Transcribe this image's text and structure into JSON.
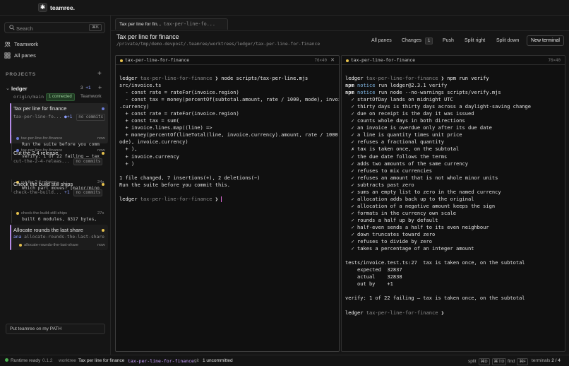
{
  "app": {
    "name": "teamree."
  },
  "sidebar": {
    "search": {
      "label": "Search",
      "shortcut": "⌘K"
    },
    "nav": [
      {
        "label": "Teamwork",
        "icon": "team-icon"
      },
      {
        "label": "All panes",
        "icon": "grid-icon"
      }
    ],
    "projects_label": "PROJECTS",
    "project": {
      "name": "ledger",
      "count_a": "3",
      "count_b": "+1",
      "branch": "origin/main",
      "connected": "1 connected",
      "team": "Teamwork"
    },
    "worktrees": [
      {
        "title": "Tax per line for finance",
        "branch": "tax-per-line-fo...",
        "badge_count": "+1",
        "badge": "no commits",
        "events": [
          {
            "name": "tax-per-line-for-finance",
            "time": "now",
            "msg": "Run the suite before you commit..."
          },
          {
            "name": "tax-per-line-for-finance",
            "time": "now",
            "msg": "verify: 1 of 22 failing — tax is..."
          }
        ]
      },
      {
        "title": "Cut the 2.4 release",
        "branch": "cut-the-2-4-releas...",
        "badge": "no commits",
        "events": [
          {
            "name": "cut-the-2-4-release",
            "time": "24s",
            "msg": "Which part moves? [major/minor/..."
          }
        ]
      },
      {
        "title": "Check the build still ships",
        "branch": "check-the-build...",
        "badge_count": "+1",
        "badge": "no commits",
        "events": [
          {
            "name": "check-the-build-still-ships",
            "time": "27s",
            "msg": "built 6 modules, 8317 bytes, 112..."
          }
        ]
      },
      {
        "title": "Allocate rounds the last share",
        "author": "ana",
        "branch": "allocate-rounds-the-last-share",
        "events": [
          {
            "name": "allocate-rounds-the-last-share",
            "time": "now",
            "msg": ""
          }
        ]
      }
    ],
    "path_button": "Put teamree on my PATH"
  },
  "header": {
    "tab": {
      "title": "Tax per line for fin...",
      "branch": "tax-per-line-fo..."
    },
    "title": "Tax per line for finance",
    "path": "/private/tmp/demo-devpost/.teamree/worktrees/ledger/tax-per-line-for-finance",
    "buttons": {
      "all_panes": "All panes",
      "changes": "Changes",
      "changes_count": "1",
      "push": "Push",
      "split_right": "Split right",
      "split_down": "Split down",
      "new_terminal": "New terminal"
    }
  },
  "panes": {
    "left": {
      "title": "tax-per-line-for-finance",
      "size": "76×40",
      "lines": [
        [
          [
            "c-white",
            "ledger "
          ],
          [
            "c-dim",
            "tax-per-line-for-finance "
          ],
          [
            "c-white",
            "❯ node scripts/tax-per-line.mjs"
          ]
        ],
        [
          [
            "c-ok",
            "src/invoice.ts"
          ]
        ],
        [
          [
            "c-ok",
            "  - const rate = rateFor(invoice.region)"
          ]
        ],
        [
          [
            "c-ok",
            "  - const tax = money(percentOf(subtotal.amount, rate / 1000, mode), invoice"
          ]
        ],
        [
          [
            "c-ok",
            ".currency)"
          ]
        ],
        [
          [
            "c-ok",
            "  + const rate = rateFor(invoice.region)"
          ]
        ],
        [
          [
            "c-ok",
            "  + const tax = sum("
          ]
        ],
        [
          [
            "c-ok",
            "  + invoice.lines.map((line) =>"
          ]
        ],
        [
          [
            "c-ok",
            "  + money(percentOf(lineTotal(line, invoice.currency).amount, rate / 1000, m"
          ]
        ],
        [
          [
            "c-ok",
            "ode), invoice.currency)"
          ]
        ],
        [
          [
            "c-ok",
            "  + ),"
          ]
        ],
        [
          [
            "c-ok",
            "  + invoice.currency"
          ]
        ],
        [
          [
            "c-ok",
            "  + )"
          ]
        ],
        [
          [
            "c-ok",
            ""
          ]
        ],
        [
          [
            "c-ok",
            "1 file changed, 7 insertions(+), 2 deletions(−)"
          ]
        ],
        [
          [
            "c-ok",
            "Run the suite before you commit this."
          ]
        ],
        [
          [
            "c-ok",
            ""
          ]
        ],
        [
          [
            "c-white",
            "ledger "
          ],
          [
            "c-dim",
            "tax-per-line-for-finance "
          ],
          [
            "c-white",
            "❯ "
          ],
          [
            "caret",
            ""
          ]
        ]
      ]
    },
    "right": {
      "title": "tax-per-line-for-finance",
      "size": "76×40",
      "lines": [
        [
          [
            "c-white",
            "ledger "
          ],
          [
            "c-dim",
            "tax-per-line-for-finance "
          ],
          [
            "c-white",
            "❯ npm run verify"
          ]
        ],
        [
          [
            "c-npm",
            "npm "
          ],
          [
            "c-notice",
            "notice "
          ],
          [
            "c-ok",
            "run ledger@2.3.1 verify"
          ]
        ],
        [
          [
            "c-npm",
            "npm "
          ],
          [
            "c-notice",
            "notice "
          ],
          [
            "c-ok",
            "run node --no-warnings scripts/verify.mjs"
          ]
        ],
        [
          [
            "c-ok",
            "  ✓ startOfDay lands on midnight UTC"
          ]
        ],
        [
          [
            "c-ok",
            "  ✓ thirty days is thirty days across a daylight-saving change"
          ]
        ],
        [
          [
            "c-ok",
            "  ✓ due on receipt is the day it was issued"
          ]
        ],
        [
          [
            "c-ok",
            "  ✓ counts whole days in both directions"
          ]
        ],
        [
          [
            "c-ok",
            "  ✓ an invoice is overdue only after its due date"
          ]
        ],
        [
          [
            "c-ok",
            "  ✓ a line is quantity times unit price"
          ]
        ],
        [
          [
            "c-ok",
            "  ✓ refuses a fractional quantity"
          ]
        ],
        [
          [
            "c-x",
            "  ✗ tax is taken once, on the subtotal"
          ]
        ],
        [
          [
            "c-ok",
            "  ✓ the due date follows the terms"
          ]
        ],
        [
          [
            "c-ok",
            "  ✓ adds two amounts of the same currency"
          ]
        ],
        [
          [
            "c-ok",
            "  ✓ refuses to mix currencies"
          ]
        ],
        [
          [
            "c-ok",
            "  ✓ refuses an amount that is not whole minor units"
          ]
        ],
        [
          [
            "c-ok",
            "  ✓ subtracts past zero"
          ]
        ],
        [
          [
            "c-ok",
            "  ✓ sums an empty list to zero in the named currency"
          ]
        ],
        [
          [
            "c-ok",
            "  ✓ allocation adds back up to the original"
          ]
        ],
        [
          [
            "c-ok",
            "  ✓ allocation of a negative amount keeps the sign"
          ]
        ],
        [
          [
            "c-ok",
            "  ✓ formats in the currency own scale"
          ]
        ],
        [
          [
            "c-ok",
            "  ✓ rounds a half up by default"
          ]
        ],
        [
          [
            "c-ok",
            "  ✓ half-even sends a half to its even neighbour"
          ]
        ],
        [
          [
            "c-ok",
            "  ✓ down truncates toward zero"
          ]
        ],
        [
          [
            "c-ok",
            "  ✓ refuses to divide by zero"
          ]
        ],
        [
          [
            "c-ok",
            "  ✓ takes a percentage of an integer amount"
          ]
        ],
        [
          [
            "c-ok",
            ""
          ]
        ],
        [
          [
            "c-ok",
            "tests/invoice.test.ts:27  tax is taken once, on the subtotal"
          ]
        ],
        [
          [
            "c-ok",
            "    expected  32837"
          ]
        ],
        [
          [
            "c-ok",
            "    actual    32838"
          ]
        ],
        [
          [
            "c-ok",
            "    out by    +1"
          ]
        ],
        [
          [
            "c-ok",
            ""
          ]
        ],
        [
          [
            "c-ok",
            "verify: 1 of 22 failing — tax is taken once, on the subtotal"
          ]
        ],
        [
          [
            "c-ok",
            ""
          ]
        ],
        [
          [
            "c-white",
            "ledger "
          ],
          [
            "c-dim",
            "tax-per-line-for-finance "
          ],
          [
            "c-white",
            "❯"
          ]
        ]
      ]
    }
  },
  "status": {
    "runtime": "Runtime ready",
    "version": "0.1.2",
    "worktree_label": "worktree",
    "worktree_title": "Tax per line for finance",
    "worktree_branch": "tax-per-line-for-finance",
    "git_label": "git",
    "git_value": "1 uncommitted",
    "split_label": "split",
    "split_k1": "⌘D",
    "split_k2": "⌘⇧D",
    "find_label": "find",
    "find_k": "⌘F",
    "terminals_label": "terminals",
    "terminals_value": "2 / 4"
  },
  "colors": {
    "accent_purple": "#b48ae6",
    "dot_yellow": "#e6c14d",
    "dot_blue": "#6a7bd6",
    "dot_green": "#4caf50"
  }
}
